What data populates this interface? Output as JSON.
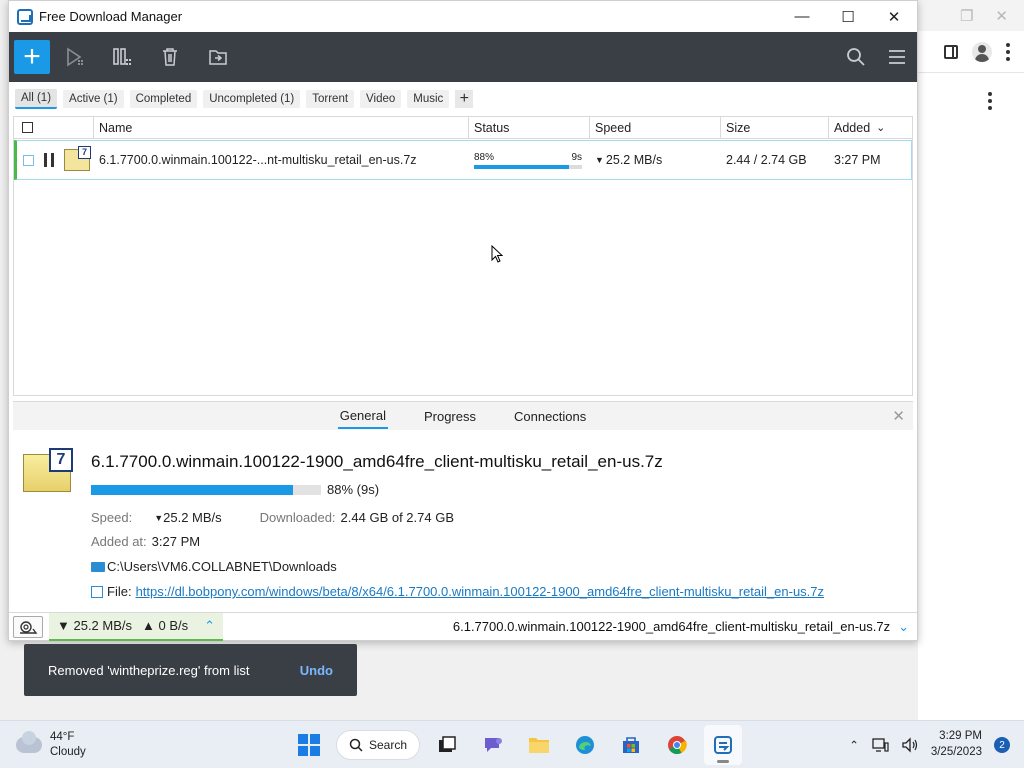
{
  "window": {
    "title": "Free Download Manager",
    "controls": {
      "minimize": "—",
      "maximize": "☐",
      "close": "✕"
    }
  },
  "toolbar": {
    "add_label": "+",
    "buttons": [
      "play-icon",
      "pause-all-icon",
      "trash-icon",
      "move-folder-icon"
    ],
    "right_buttons": [
      "search-icon",
      "menu-icon"
    ]
  },
  "filters": [
    {
      "label": "All (1)",
      "active": true
    },
    {
      "label": "Active (1)",
      "active": false
    },
    {
      "label": "Completed",
      "active": false
    },
    {
      "label": "Uncompleted (1)",
      "active": false
    },
    {
      "label": "Torrent",
      "active": false
    },
    {
      "label": "Video",
      "active": false
    },
    {
      "label": "Music",
      "active": false
    }
  ],
  "filter_add": "+",
  "table": {
    "columns": [
      "Name",
      "Status",
      "Speed",
      "Size",
      "Added"
    ],
    "sort_indicator": "⌄",
    "rows": [
      {
        "name": "6.1.7700.0.winmain.100122-...nt-multisku_retail_en-us.7z",
        "status_percent": "88%",
        "status_time": "9s",
        "progress": 0.88,
        "speed": "25.2 MB/s",
        "size": "2.44 / 2.74 GB",
        "added": "3:27 PM"
      }
    ]
  },
  "details": {
    "tabs": [
      "General",
      "Progress",
      "Connections"
    ],
    "active_tab": "General",
    "file_name": "6.1.7700.0.winmain.100122-1900_amd64fre_client-multisku_retail_en-us.7z",
    "progress": 0.88,
    "progress_text": "88% (9s)",
    "speed_label": "Speed:",
    "speed_value": "25.2 MB/s",
    "downloaded_label": "Downloaded:",
    "downloaded_value": "2.44 GB of 2.74 GB",
    "added_label": "Added at:",
    "added_value": "3:27 PM",
    "folder": "C:\\Users\\VM6.COLLABNET\\Downloads",
    "file_label": "File:",
    "url": "https://dl.bobpony.com/windows/beta/8/x64/6.1.7700.0.winmain.100122-1900_amd64fre_client-multisku_retail_en-us.7z"
  },
  "statusbar": {
    "down_speed": "25.2 MB/s",
    "up_speed": "0 B/s",
    "current_file": "6.1.7700.0.winmain.100122-1900_amd64fre_client-multisku_retail_en-us.7z"
  },
  "toast": {
    "message": "Removed 'wintheprize.reg' from list",
    "action": "Undo"
  },
  "taskbar": {
    "weather_temp": "44°F",
    "weather_desc": "Cloudy",
    "search_label": "Search",
    "time": "3:29 PM",
    "date": "3/25/2023",
    "notification_count": "2"
  },
  "colors": {
    "accent": "#1a9ae6",
    "toolbar_bg": "#3a3f45",
    "active_green": "#4ab84a"
  }
}
